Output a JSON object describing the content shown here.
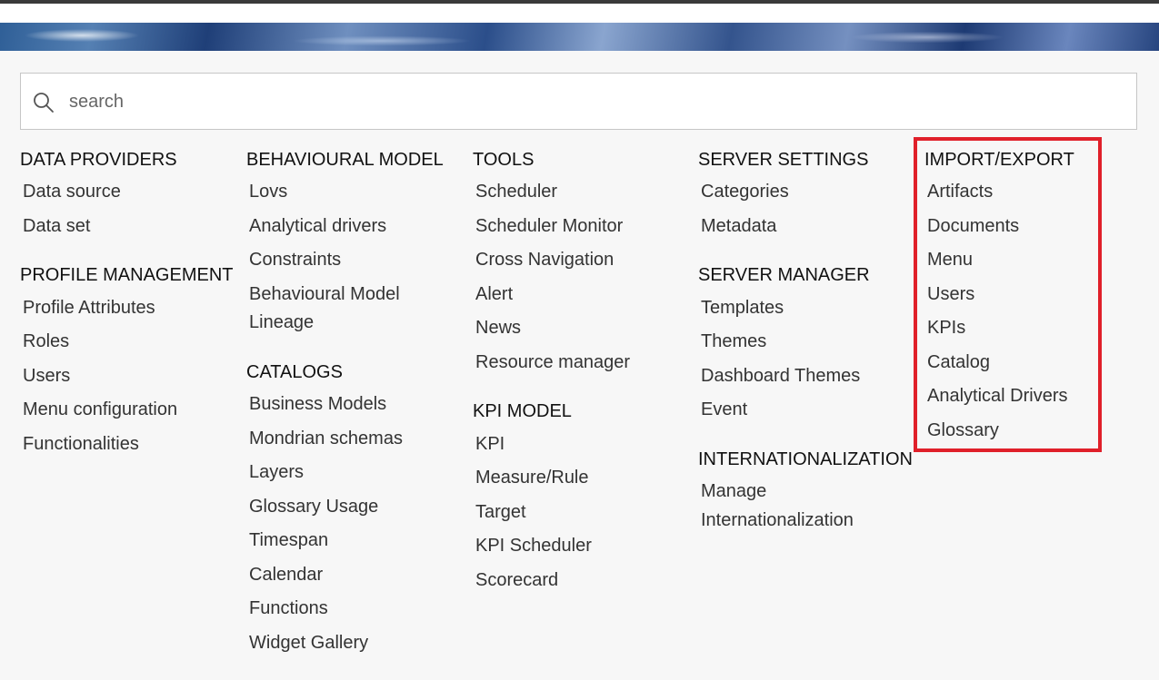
{
  "search": {
    "placeholder": "search"
  },
  "colors": {
    "highlight": "#e0202a",
    "background": "#f7f7f7"
  },
  "columns": {
    "col1": {
      "data_providers": {
        "title": "DATA PROVIDERS",
        "items": [
          "Data source",
          "Data set"
        ]
      },
      "profile_management": {
        "title": "PROFILE MANAGEMENT",
        "items": [
          "Profile Attributes",
          "Roles",
          "Users",
          "Menu configuration",
          "Functionalities"
        ]
      }
    },
    "col2": {
      "behavioural_model": {
        "title": "BEHAVIOURAL MODEL",
        "items": [
          "Lovs",
          "Analytical drivers",
          "Constraints",
          "Behavioural Model",
          "Lineage"
        ]
      },
      "catalogs": {
        "title": "CATALOGS",
        "items": [
          "Business Models",
          "Mondrian schemas",
          "Layers",
          "Glossary Usage",
          "Timespan",
          "Calendar",
          "Functions",
          "Widget Gallery"
        ]
      }
    },
    "col3": {
      "tools": {
        "title": "TOOLS",
        "items": [
          "Scheduler",
          "Scheduler Monitor",
          "Cross Navigation",
          "Alert",
          "News",
          "Resource manager"
        ]
      },
      "kpi_model": {
        "title": "KPI MODEL",
        "items": [
          "KPI",
          "Measure/Rule",
          "Target",
          "KPI Scheduler",
          "Scorecard"
        ]
      }
    },
    "col4": {
      "server_settings": {
        "title": "SERVER SETTINGS",
        "items": [
          "Categories",
          "Metadata"
        ]
      },
      "server_manager": {
        "title": "SERVER MANAGER",
        "items": [
          "Templates",
          "Themes",
          "Dashboard Themes",
          "Event"
        ]
      },
      "internationalization": {
        "title": "INTERNATIONALIZATION",
        "items": [
          "Manage",
          "Internationalization"
        ]
      }
    },
    "col5": {
      "import_export": {
        "title": "IMPORT/EXPORT",
        "items": [
          "Artifacts",
          "Documents",
          "Menu",
          "Users",
          "KPIs",
          "Catalog",
          "Analytical Drivers",
          "Glossary"
        ]
      }
    }
  }
}
